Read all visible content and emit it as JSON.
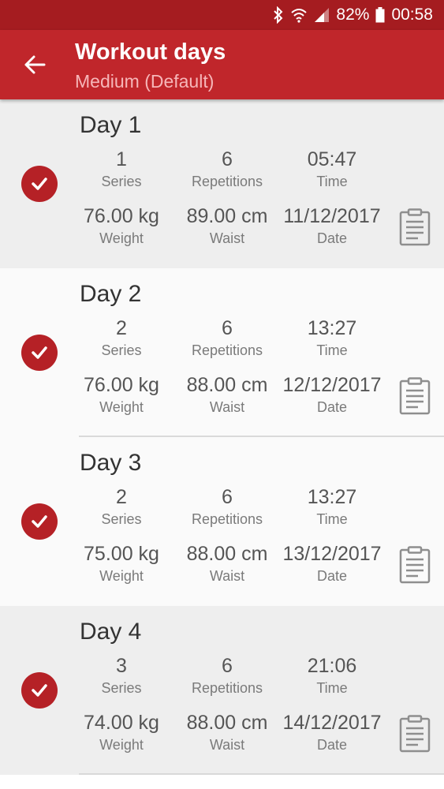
{
  "status": {
    "battery": "82%",
    "time": "00:58"
  },
  "header": {
    "title": "Workout days",
    "subtitle": "Medium (Default)"
  },
  "days": [
    {
      "name": "Day  1",
      "series": "1",
      "series_label": "Series",
      "reps": "6",
      "reps_label": "Repetitions",
      "time": "05:47",
      "time_label": "Time",
      "weight": "76.00 kg",
      "weight_label": "Weight",
      "waist": "89.00 cm",
      "waist_label": "Waist",
      "date": "11/12/2017",
      "date_label": "Date"
    },
    {
      "name": "Day  2",
      "series": "2",
      "series_label": "Series",
      "reps": "6",
      "reps_label": "Repetitions",
      "time": "13:27",
      "time_label": "Time",
      "weight": "76.00 kg",
      "weight_label": "Weight",
      "waist": "88.00 cm",
      "waist_label": "Waist",
      "date": "12/12/2017",
      "date_label": "Date"
    },
    {
      "name": "Day  3",
      "series": "2",
      "series_label": "Series",
      "reps": "6",
      "reps_label": "Repetitions",
      "time": "13:27",
      "time_label": "Time",
      "weight": "75.00 kg",
      "weight_label": "Weight",
      "waist": "88.00 cm",
      "waist_label": "Waist",
      "date": "13/12/2017",
      "date_label": "Date"
    },
    {
      "name": "Day  4",
      "series": "3",
      "series_label": "Series",
      "reps": "6",
      "reps_label": "Repetitions",
      "time": "21:06",
      "time_label": "Time",
      "weight": "74.00 kg",
      "weight_label": "Weight",
      "waist": "88.00 cm",
      "waist_label": "Waist",
      "date": "14/12/2017",
      "date_label": "Date"
    }
  ]
}
